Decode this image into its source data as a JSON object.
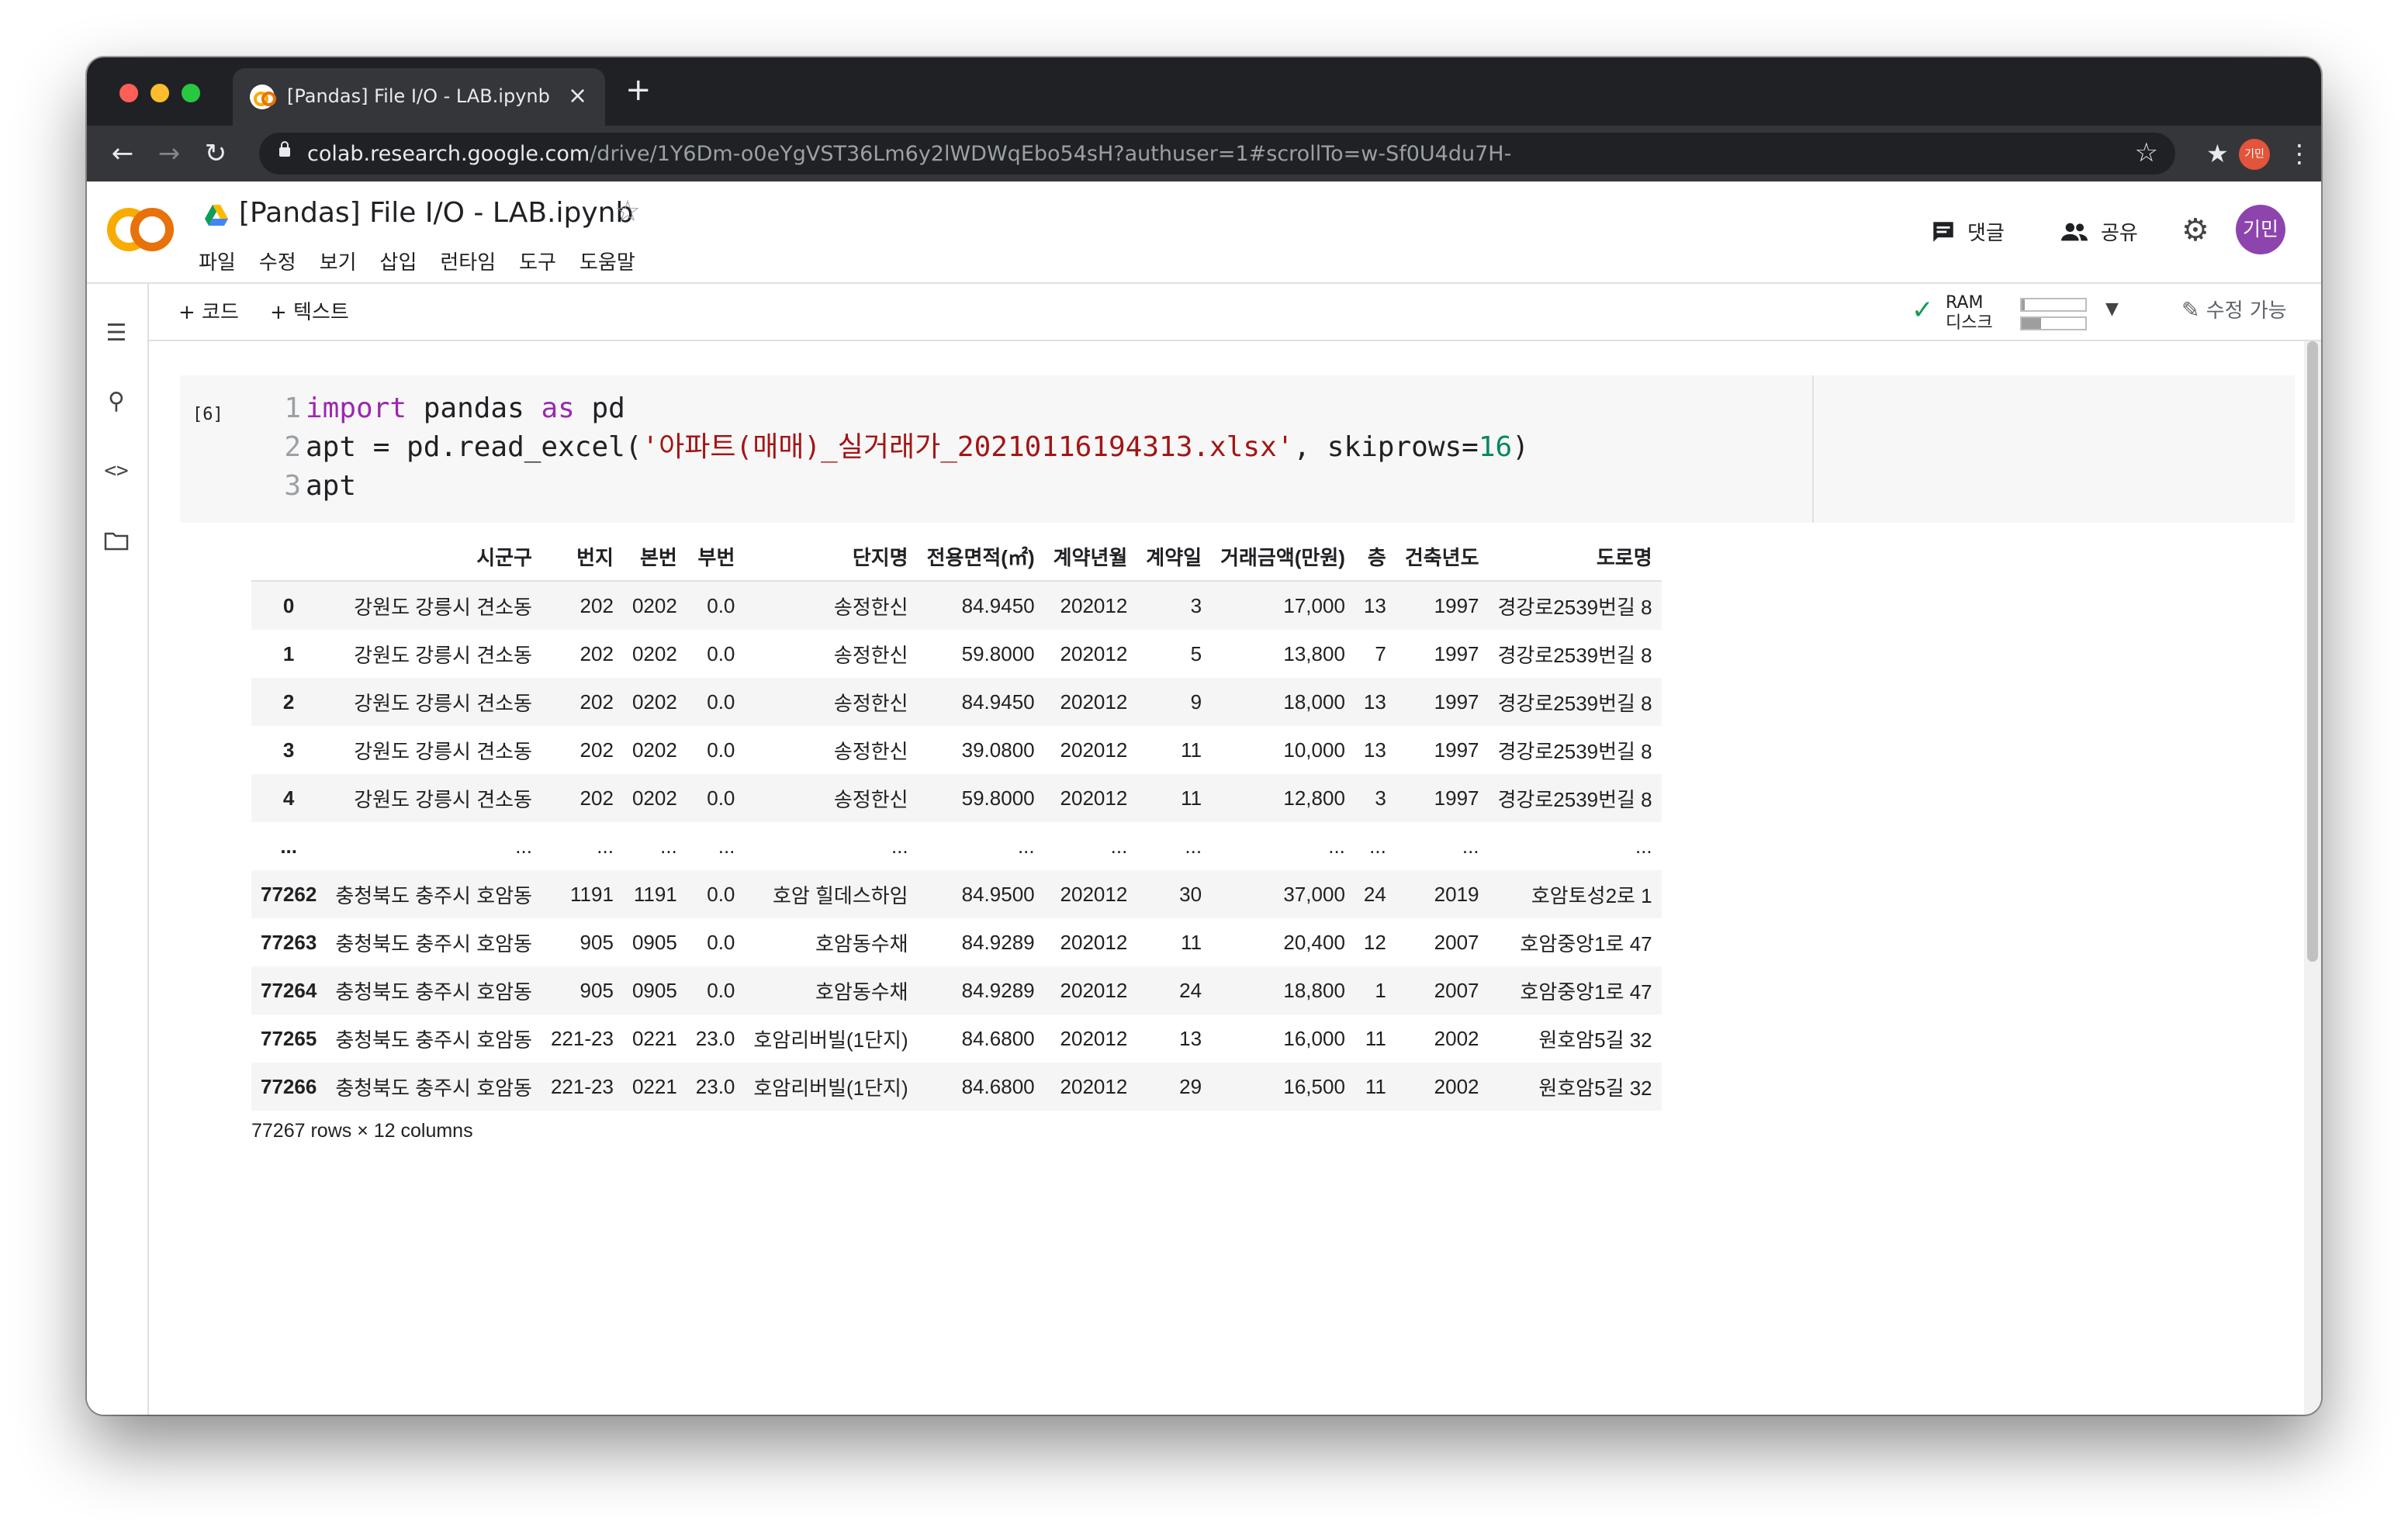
{
  "browser": {
    "tab_title": "[Pandas] File I/O - LAB.ipynb -",
    "url_host": "colab.research.google.com",
    "url_path": "/drive/1Y6Dm-o0eYgVST36Lm6y2lWDWqEbo54sH?authuser=1#scrollTo=w-Sf0U4du7H-",
    "profile_initials": "기민"
  },
  "colab": {
    "title": "[Pandas] File I/O - LAB.ipynb",
    "menu": [
      "파일",
      "수정",
      "보기",
      "삽입",
      "런타임",
      "도구",
      "도움말"
    ],
    "comment_label": "댓글",
    "share_label": "공유",
    "avatar_initials": "기민"
  },
  "toolbar": {
    "add_code": "+ 코드",
    "add_text": "+ 텍스트",
    "ram_label": "RAM",
    "disk_label": "디스크",
    "ram_usage": 0.05,
    "disk_usage": 0.3,
    "edit_label": "수정 가능"
  },
  "cell": {
    "execution_count": "[6]",
    "line_numbers": [
      "1",
      "2",
      "3"
    ],
    "line1": {
      "kw1": "import",
      "mid": " pandas ",
      "kw2": "as",
      "end": " pd"
    },
    "line2": {
      "pre": "apt = pd.read_excel(",
      "string": "'아파트(매매)_실거래가_20210116194313.xlsx'",
      "mid": ", skiprows=",
      "num": "16",
      "end": ")"
    },
    "line3": "apt"
  },
  "output": {
    "columns": [
      "",
      "시군구",
      "번지",
      "본번",
      "부번",
      "단지명",
      "전용면적(㎡)",
      "계약년월",
      "계약일",
      "거래금액(만원)",
      "층",
      "건축년도",
      "도로명"
    ],
    "rows": [
      [
        "0",
        "강원도 강릉시 견소동",
        "202",
        "0202",
        "0.0",
        "송정한신",
        "84.9450",
        "202012",
        "3",
        "17,000",
        "13",
        "1997",
        "경강로2539번길 8"
      ],
      [
        "1",
        "강원도 강릉시 견소동",
        "202",
        "0202",
        "0.0",
        "송정한신",
        "59.8000",
        "202012",
        "5",
        "13,800",
        "7",
        "1997",
        "경강로2539번길 8"
      ],
      [
        "2",
        "강원도 강릉시 견소동",
        "202",
        "0202",
        "0.0",
        "송정한신",
        "84.9450",
        "202012",
        "9",
        "18,000",
        "13",
        "1997",
        "경강로2539번길 8"
      ],
      [
        "3",
        "강원도 강릉시 견소동",
        "202",
        "0202",
        "0.0",
        "송정한신",
        "39.0800",
        "202012",
        "11",
        "10,000",
        "13",
        "1997",
        "경강로2539번길 8"
      ],
      [
        "4",
        "강원도 강릉시 견소동",
        "202",
        "0202",
        "0.0",
        "송정한신",
        "59.8000",
        "202012",
        "11",
        "12,800",
        "3",
        "1997",
        "경강로2539번길 8"
      ],
      [
        "...",
        "...",
        "...",
        "...",
        "...",
        "...",
        "...",
        "...",
        "...",
        "...",
        "...",
        "...",
        "..."
      ],
      [
        "77262",
        "충청북도 충주시 호암동",
        "1191",
        "1191",
        "0.0",
        "호암 힐데스하임",
        "84.9500",
        "202012",
        "30",
        "37,000",
        "24",
        "2019",
        "호암토성2로 1"
      ],
      [
        "77263",
        "충청북도 충주시 호암동",
        "905",
        "0905",
        "0.0",
        "호암동수채",
        "84.9289",
        "202012",
        "11",
        "20,400",
        "12",
        "2007",
        "호암중앙1로 47"
      ],
      [
        "77264",
        "충청북도 충주시 호암동",
        "905",
        "0905",
        "0.0",
        "호암동수채",
        "84.9289",
        "202012",
        "24",
        "18,800",
        "1",
        "2007",
        "호암중앙1로 47"
      ],
      [
        "77265",
        "충청북도 충주시 호암동",
        "221-23",
        "0221",
        "23.0",
        "호암리버빌(1단지)",
        "84.6800",
        "202012",
        "13",
        "16,000",
        "11",
        "2002",
        "원호암5길 32"
      ],
      [
        "77266",
        "충청북도 충주시 호암동",
        "221-23",
        "0221",
        "23.0",
        "호암리버빌(1단지)",
        "84.6800",
        "202012",
        "29",
        "16,500",
        "11",
        "2002",
        "원호암5길 32"
      ]
    ],
    "summary": "77267 rows × 12 columns"
  }
}
